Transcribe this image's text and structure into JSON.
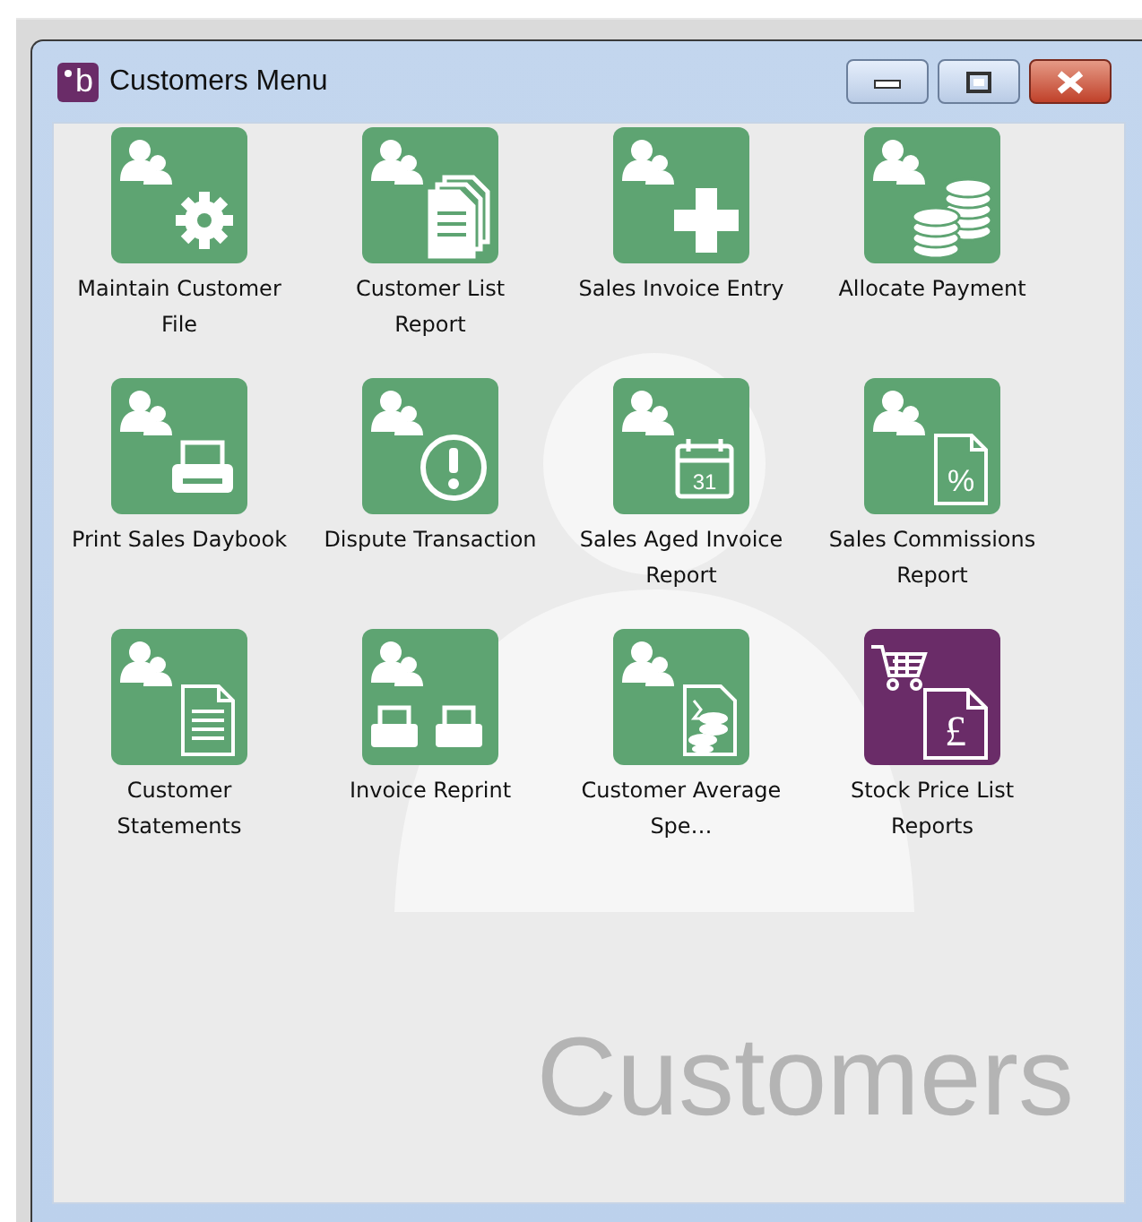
{
  "window": {
    "title": "Customers Menu",
    "app_icon_letter": "b"
  },
  "items": [
    {
      "label": "Maintain Customer File",
      "kind": "gear",
      "color": "#5ea472"
    },
    {
      "label": "Customer List Report",
      "kind": "documents",
      "color": "#5ea472"
    },
    {
      "label": "Sales Invoice Entry",
      "kind": "plus",
      "color": "#5ea472"
    },
    {
      "label": "Allocate Payment",
      "kind": "coins",
      "color": "#5ea472"
    },
    {
      "label": "Print Sales Daybook",
      "kind": "printer",
      "color": "#5ea472"
    },
    {
      "label": "Dispute Transaction",
      "kind": "alert",
      "color": "#5ea472"
    },
    {
      "label": "Sales Aged Invoice Report",
      "kind": "calendar",
      "color": "#5ea472",
      "glyph_text": "31"
    },
    {
      "label": "Sales Commissions Report",
      "kind": "percent",
      "color": "#5ea472",
      "glyph_text": "%"
    },
    {
      "label": "Customer Statements",
      "kind": "statement",
      "color": "#5ea472"
    },
    {
      "label": "Invoice Reprint",
      "kind": "printers",
      "color": "#5ea472"
    },
    {
      "label": "Customer Average Spe…",
      "kind": "average",
      "color": "#5ea472"
    },
    {
      "label": "Stock Price List Reports",
      "kind": "cart",
      "color": "#6a2c68",
      "glyph_text": "£"
    }
  ],
  "background_caption": "Customers"
}
